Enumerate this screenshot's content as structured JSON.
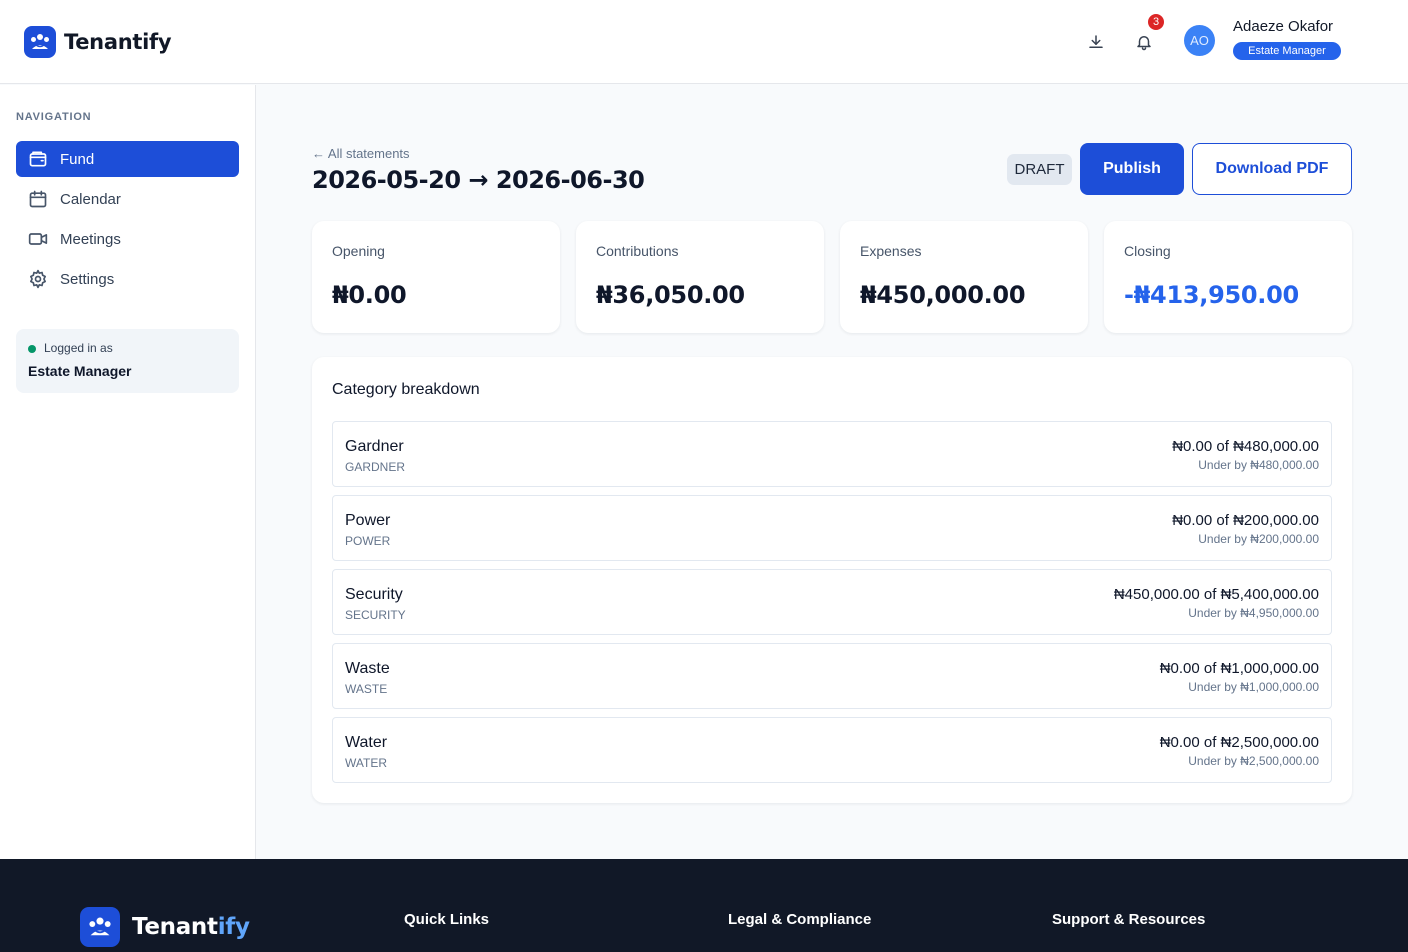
{
  "brand": {
    "name": "Tenantify",
    "footer_name_a": "Tenant",
    "footer_name_b": "ify",
    "accent": "#1d4ed8"
  },
  "header": {
    "notification_count": "3",
    "user_initials": "AO",
    "user_name": "Adaeze Okafor",
    "user_role": "Estate Manager"
  },
  "sidebar": {
    "heading": "NAVIGATION",
    "items": [
      {
        "label": "Fund",
        "icon": "wallet-icon",
        "active": true
      },
      {
        "label": "Calendar",
        "icon": "calendar-icon",
        "active": false
      },
      {
        "label": "Meetings",
        "icon": "video-icon",
        "active": false
      },
      {
        "label": "Settings",
        "icon": "gear-icon",
        "active": false
      }
    ],
    "login_label": "Logged in as",
    "login_role": "Estate Manager"
  },
  "main": {
    "back_link": "← All statements",
    "title": "2026-05-20 → 2026-06-30",
    "status": "DRAFT",
    "publish_label": "Publish",
    "download_label": "Download PDF",
    "stats": [
      {
        "label": "Opening",
        "value": "₦0.00"
      },
      {
        "label": "Contributions",
        "value": "₦36,050.00"
      },
      {
        "label": "Expenses",
        "value": "₦450,000.00"
      },
      {
        "label": "Closing",
        "value": "-₦413,950.00"
      }
    ],
    "breakdown_title": "Category breakdown",
    "categories": [
      {
        "name": "Gardner",
        "code": "GARDNER",
        "amount": "₦0.00 of ₦480,000.00",
        "under": "Under by ₦480,000.00"
      },
      {
        "name": "Power",
        "code": "POWER",
        "amount": "₦0.00 of ₦200,000.00",
        "under": "Under by ₦200,000.00"
      },
      {
        "name": "Security",
        "code": "SECURITY",
        "amount": "₦450,000.00 of ₦5,400,000.00",
        "under": "Under by ₦4,950,000.00"
      },
      {
        "name": "Waste",
        "code": "WASTE",
        "amount": "₦0.00 of ₦1,000,000.00",
        "under": "Under by ₦1,000,000.00"
      },
      {
        "name": "Water",
        "code": "WATER",
        "amount": "₦0.00 of ₦2,500,000.00",
        "under": "Under by ₦2,500,000.00"
      }
    ]
  },
  "footer": {
    "quick_links": "Quick Links",
    "legal": "Legal & Compliance",
    "support": "Support & Resources"
  }
}
